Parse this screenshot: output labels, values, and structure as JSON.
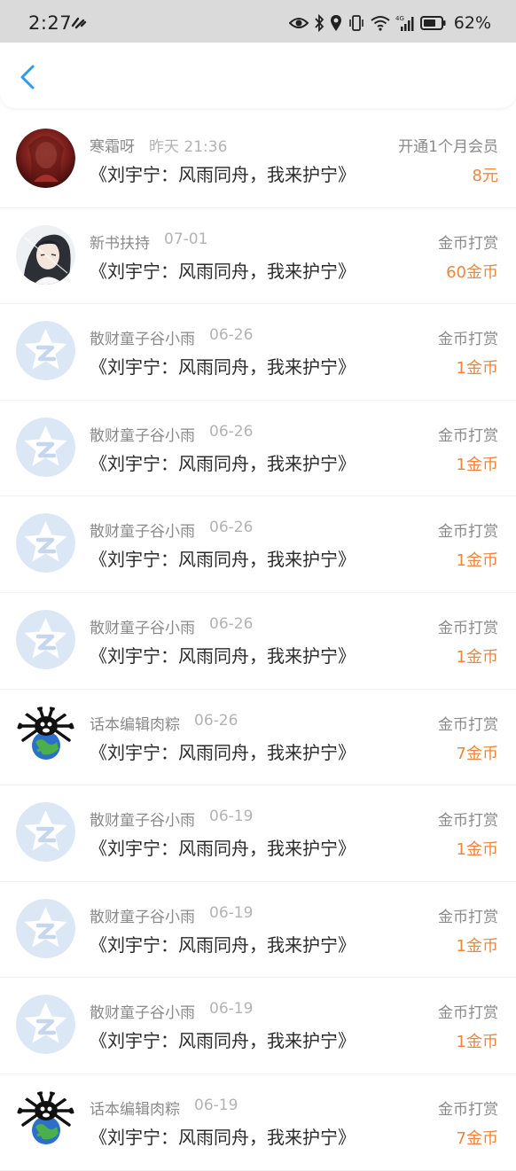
{
  "status_bar": {
    "time": "2:27",
    "battery": "62%"
  },
  "list": [
    {
      "name": "寒霜呀",
      "date": "昨天 21:36",
      "title": "《刘宇宁：风雨同舟，我来护宁》",
      "type": "开通1个月会员",
      "amount": "8元",
      "avatar": "red-portrait"
    },
    {
      "name": "新书扶持",
      "date": "07-01",
      "title": "《刘宇宁：风雨同舟，我来护宁》",
      "type": "金币打赏",
      "amount": "60金币",
      "avatar": "anime-character"
    },
    {
      "name": "散财童子谷小雨",
      "date": "06-26",
      "title": "《刘宇宁：风雨同舟，我来护宁》",
      "type": "金币打赏",
      "amount": "1金币",
      "avatar": "default-star"
    },
    {
      "name": "散财童子谷小雨",
      "date": "06-26",
      "title": "《刘宇宁：风雨同舟，我来护宁》",
      "type": "金币打赏",
      "amount": "1金币",
      "avatar": "default-star"
    },
    {
      "name": "散财童子谷小雨",
      "date": "06-26",
      "title": "《刘宇宁：风雨同舟，我来护宁》",
      "type": "金币打赏",
      "amount": "1金币",
      "avatar": "default-star"
    },
    {
      "name": "散财童子谷小雨",
      "date": "06-26",
      "title": "《刘宇宁：风雨同舟，我来护宁》",
      "type": "金币打赏",
      "amount": "1金币",
      "avatar": "default-star"
    },
    {
      "name": "话本编辑肉粽",
      "date": "06-26",
      "title": "《刘宇宁：风雨同舟，我来护宁》",
      "type": "金币打赏",
      "amount": "7金币",
      "avatar": "cartoon-globe"
    },
    {
      "name": "散财童子谷小雨",
      "date": "06-19",
      "title": "《刘宇宁：风雨同舟，我来护宁》",
      "type": "金币打赏",
      "amount": "1金币",
      "avatar": "default-star"
    },
    {
      "name": "散财童子谷小雨",
      "date": "06-19",
      "title": "《刘宇宁：风雨同舟，我来护宁》",
      "type": "金币打赏",
      "amount": "1金币",
      "avatar": "default-star"
    },
    {
      "name": "散财童子谷小雨",
      "date": "06-19",
      "title": "《刘宇宁：风雨同舟，我来护宁》",
      "type": "金币打赏",
      "amount": "1金币",
      "avatar": "default-star"
    },
    {
      "name": "话本编辑肉粽",
      "date": "06-19",
      "title": "《刘宇宁：风雨同舟，我来护宁》",
      "type": "金币打赏",
      "amount": "7金币",
      "avatar": "cartoon-globe"
    }
  ],
  "colors": {
    "accent": "#2f9be8",
    "amount": "#f0853b",
    "status_bar_bg": "#dadada"
  }
}
